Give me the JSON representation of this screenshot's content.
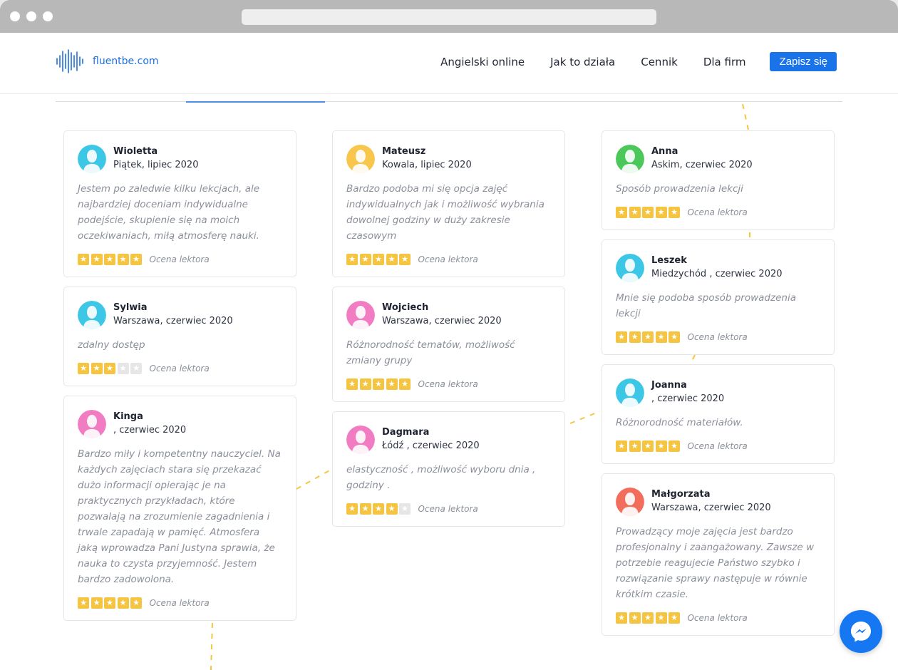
{
  "header": {
    "logo_text": "fluentbe.com",
    "nav": [
      "Angielski online",
      "Jak to działa",
      "Cennik",
      "Dla firm"
    ],
    "cta": "Zapisz się"
  },
  "colors": {
    "accent": "#1a73e8",
    "star": "#f5c542",
    "dash": "#f5c542"
  },
  "reviews": [
    {
      "name": "Wioletta",
      "location": "Piątek, lipiec 2020",
      "text": "Jestem po zaledwie kilku lekcjach, ale najbardziej doceniam indywidualne podejście, skupienie się na moich oczekiwaniach, miłą atmosferę nauki.",
      "stars": 5,
      "rating_label": "Ocena lektora",
      "avatar_color": "#3cc7e6"
    },
    {
      "name": "Sylwia",
      "location": "Warszawa, czerwiec 2020",
      "text": "zdalny dostęp",
      "stars": 3,
      "rating_label": "Ocena lektora",
      "avatar_color": "#3cc7e6"
    },
    {
      "name": "Kinga",
      "location": ", czerwiec 2020",
      "text": "Bardzo miły i kompetentny nauczyciel. Na każdych zajęciach stara się przekazać dużo informacji opierając je na praktycznych przykładach, które pozwalają na zrozumienie zagadnienia i trwale zapadają w pamięć. Atmosfera jaką wprowadza Pani Justyna sprawia, że nauka to czysta przyjemność. Jestem bardzo zadowolona.",
      "stars": 5,
      "rating_label": "Ocena lektora",
      "avatar_color": "#f27cc2"
    },
    {
      "name": "Mateusz",
      "location": "Kowala, lipiec 2020",
      "text": "Bardzo podoba mi się opcja zajęć indywidualnych jak i możliwość wybrania dowolnej godziny w duży zakresie czasowym",
      "stars": 5,
      "rating_label": "Ocena lektora",
      "avatar_color": "#f7c64a"
    },
    {
      "name": "Wojciech",
      "location": "Warszawa, czerwiec 2020",
      "text": "Różnorodność tematów, możliwość zmiany grupy",
      "stars": 5,
      "rating_label": "Ocena lektora",
      "avatar_color": "#f27cc2"
    },
    {
      "name": "Dagmara",
      "location": "Łódź , czerwiec 2020",
      "text": "elastyczność , możliwość wyboru dnia , godziny .",
      "stars": 4,
      "rating_label": "Ocena lektora",
      "avatar_color": "#f27cc2"
    },
    {
      "name": "Anna",
      "location": "Askim, czerwiec 2020",
      "text": "Sposób prowadzenia lekcji",
      "stars": 5,
      "rating_label": "Ocena lektora",
      "avatar_color": "#4cc85a"
    },
    {
      "name": "Leszek",
      "location": "Miedzychód , czerwiec 2020",
      "text": "Mnie się podoba sposób prowadzenia lekcji",
      "stars": 5,
      "rating_label": "Ocena lektora",
      "avatar_color": "#3cc7e6"
    },
    {
      "name": "Joanna",
      "location": ", czerwiec 2020",
      "text": "Różnorodność materiałów.",
      "stars": 5,
      "rating_label": "Ocena lektora",
      "avatar_color": "#3cc7e6"
    },
    {
      "name": "Małgorzata",
      "location": "Warszawa, czerwiec 2020",
      "text": "Prowadzący moje zajęcia jest bardzo profesjonalny i zaangażowany. Zawsze w potrzebie reagujecie Państwo szybko i rozwiązanie sprawy następuje w równie krótkim czasie.",
      "stars": 5,
      "rating_label": "Ocena lektora",
      "avatar_color": "#f26d5b"
    }
  ],
  "messenger_icon": "messenger-icon"
}
